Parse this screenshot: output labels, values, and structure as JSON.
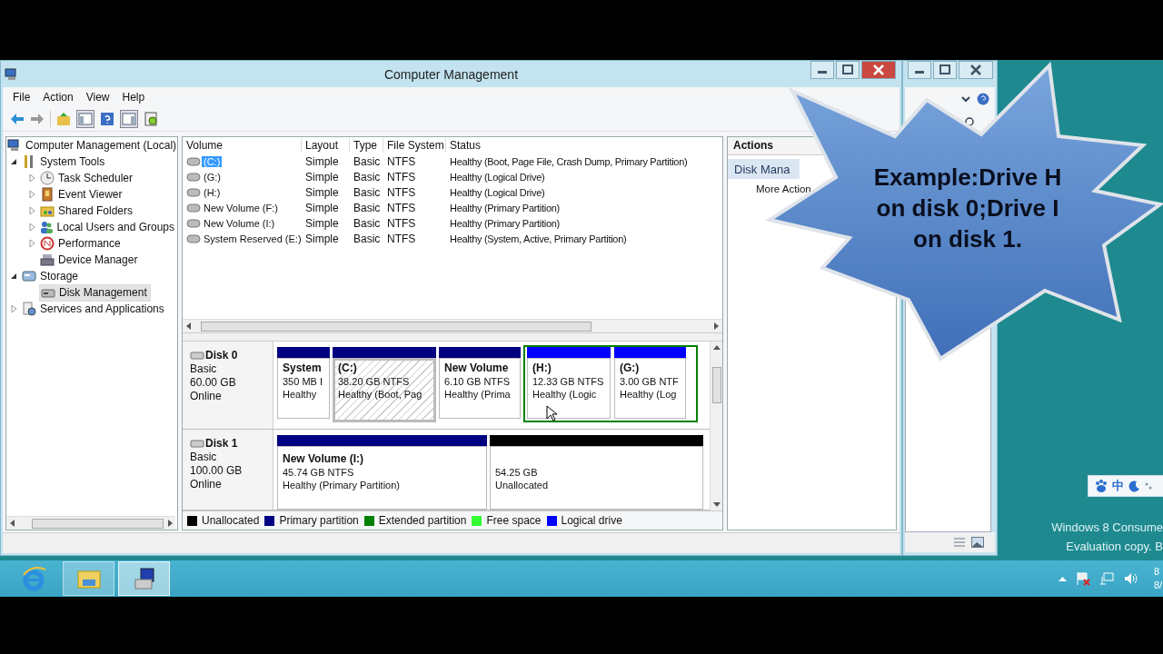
{
  "window": {
    "title": "Computer Management",
    "menu": [
      "File",
      "Action",
      "View",
      "Help"
    ]
  },
  "tree": [
    {
      "label": "Computer Management (Local)",
      "selected": false,
      "children": [
        {
          "label": "System Tools",
          "expanded": true,
          "selected": false,
          "children": [
            {
              "label": "Task Scheduler",
              "expanded": false,
              "selected": false
            },
            {
              "label": "Event Viewer",
              "expanded": false,
              "selected": false
            },
            {
              "label": "Shared Folders",
              "expanded": false,
              "selected": false
            },
            {
              "label": "Local Users and Groups",
              "expanded": false,
              "selected": false
            },
            {
              "label": "Performance",
              "expanded": false,
              "selected": false
            },
            {
              "label": "Device Manager",
              "selected": false
            }
          ]
        },
        {
          "label": "Storage",
          "expanded": true,
          "selected": false,
          "children": [
            {
              "label": "Disk Management",
              "selected": true
            }
          ]
        },
        {
          "label": "Services and Applications",
          "expanded": false,
          "selected": false
        }
      ]
    }
  ],
  "volumes": {
    "columns": [
      "Volume",
      "Layout",
      "Type",
      "File System",
      "Status"
    ],
    "rows": [
      {
        "cells": [
          "(C:)",
          "Simple",
          "Basic",
          "NTFS",
          "Healthy (Boot, Page File, Crash Dump, Primary Partition)"
        ],
        "selected": true
      },
      {
        "cells": [
          "(G:)",
          "Simple",
          "Basic",
          "NTFS",
          "Healthy (Logical Drive)"
        ],
        "selected": false
      },
      {
        "cells": [
          "(H:)",
          "Simple",
          "Basic",
          "NTFS",
          "Healthy (Logical Drive)"
        ],
        "selected": false
      },
      {
        "cells": [
          "New Volume (F:)",
          "Simple",
          "Basic",
          "NTFS",
          "Healthy (Primary Partition)"
        ],
        "selected": false
      },
      {
        "cells": [
          "New Volume (I:)",
          "Simple",
          "Basic",
          "NTFS",
          "Healthy (Primary Partition)"
        ],
        "selected": false
      },
      {
        "cells": [
          "System Reserved (E:)",
          "Simple",
          "Basic",
          "NTFS",
          "Healthy (System, Active, Primary Partition)"
        ],
        "selected": false
      }
    ]
  },
  "disks": [
    {
      "name": "Disk 0",
      "type": "Basic",
      "size": "60.00 GB",
      "status": "Online",
      "partitions": [
        {
          "kind": "primary",
          "name": "System",
          "size": "350 MB I",
          "status": "Healthy",
          "selected": false
        },
        {
          "kind": "primary",
          "name": "(C:)",
          "size": "38.20 GB NTFS",
          "status": "Healthy (Boot, Pag",
          "selected": true
        },
        {
          "kind": "primary",
          "name": "New Volume",
          "size": "6.10 GB NTFS",
          "status": "Healthy (Prima",
          "selected": false
        },
        {
          "kind": "extended",
          "children": [
            {
              "kind": "logical",
              "name": "(H:)",
              "size": "12.33 GB NTFS",
              "status": "Healthy (Logic",
              "selected": false
            },
            {
              "kind": "logical",
              "name": "(G:)",
              "size": "3.00 GB NTF",
              "status": "Healthy (Log",
              "selected": false
            }
          ]
        }
      ]
    },
    {
      "name": "Disk 1",
      "type": "Basic",
      "size": "100.00 GB",
      "status": "Online",
      "partitions": [
        {
          "kind": "primary",
          "name": "New Volume  (I:)",
          "size": "45.74 GB NTFS",
          "status": "Healthy (Primary Partition)",
          "selected": false
        },
        {
          "kind": "unallocated",
          "size": "54.25 GB",
          "status": "Unallocated",
          "selected": false
        }
      ]
    }
  ],
  "legend": [
    {
      "label": "Unallocated",
      "color": "#000000"
    },
    {
      "label": "Primary partition",
      "color": "#000080"
    },
    {
      "label": "Extended partition",
      "color": "#008000"
    },
    {
      "label": "Free space",
      "color": "#33ff33"
    },
    {
      "label": "Logical drive",
      "color": "#0000ff"
    }
  ],
  "actions": {
    "title": "Actions",
    "items": [
      {
        "label": "Disk Mana",
        "kind": "section"
      },
      {
        "label": "More Action",
        "kind": "link"
      }
    ]
  },
  "callout": {
    "text": "Example:Drive H on disk 0;Drive I on disk 1."
  },
  "desktop": {
    "ime": "中",
    "watermark": [
      "Windows 8 Consume",
      "Evaluation copy. B"
    ]
  },
  "taskbar": {
    "buttons": [
      {
        "selected": false
      },
      {
        "selected": false
      },
      {
        "selected": true
      }
    ],
    "clock": [
      "8",
      "8/"
    ]
  }
}
